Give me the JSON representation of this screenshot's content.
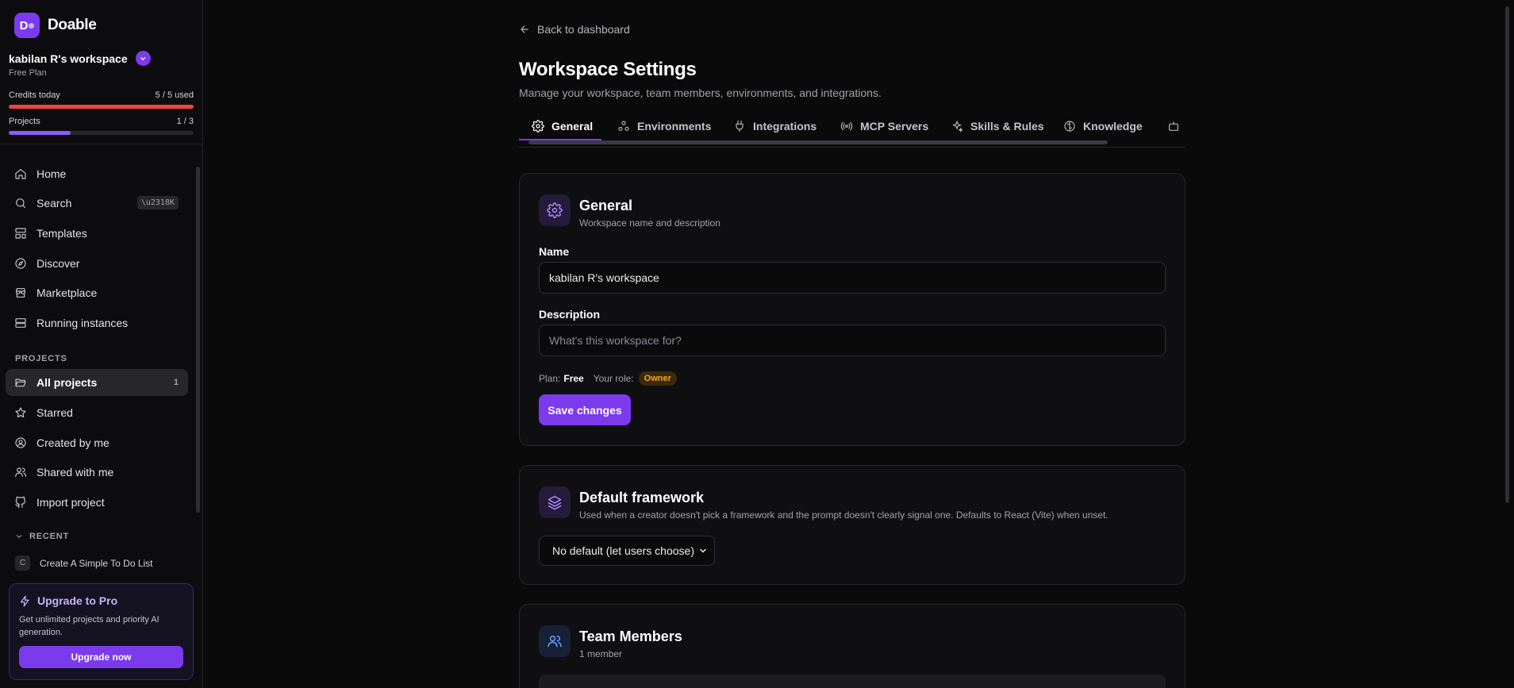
{
  "brand": {
    "name": "Doable",
    "logo_letter": "D"
  },
  "workspace": {
    "name": "kabilan R's workspace",
    "plan": "Free Plan"
  },
  "credits": {
    "label": "Credits today",
    "value": "5 / 5 used",
    "fraction": 1.0,
    "color": "#ef4444"
  },
  "projects_meter": {
    "label": "Projects",
    "value": "1 / 3",
    "fraction": 0.333,
    "color": "#8b5cf6"
  },
  "nav": {
    "home": "Home",
    "search": "Search",
    "search_shortcut": "\\u2318K",
    "templates": "Templates",
    "discover": "Discover",
    "marketplace": "Marketplace",
    "running": "Running instances"
  },
  "projects_section": {
    "label": "PROJECTS",
    "all": "All projects",
    "all_count": "1",
    "starred": "Starred",
    "created": "Created by me",
    "shared": "Shared with me",
    "import": "Import project"
  },
  "recent": {
    "label": "RECENT",
    "item_badge": "C",
    "item": "Create A Simple To Do List"
  },
  "upgrade": {
    "title": "Upgrade to Pro",
    "desc": "Get unlimited projects and priority AI generation.",
    "button": "Upgrade now"
  },
  "header": {
    "back": "Back to dashboard",
    "title": "Workspace Settings",
    "subtitle": "Manage your workspace, team members, environments, and integrations."
  },
  "tabs": [
    "General",
    "Environments",
    "Integrations",
    "MCP Servers",
    "Skills & Rules",
    "Knowledge"
  ],
  "general": {
    "title": "General",
    "subtitle": "Workspace name and description",
    "name_label": "Name",
    "name_value": "kabilan R's workspace",
    "desc_label": "Description",
    "desc_placeholder": "What's this workspace for?",
    "plan_label": "Plan:",
    "plan_value": "Free",
    "role_label": "Your role:",
    "role_value": "Owner",
    "save": "Save changes"
  },
  "framework": {
    "title": "Default framework",
    "subtitle": "Used when a creator doesn't pick a framework and the prompt doesn't clearly signal one. Defaults to React (Vite) when unset.",
    "selected": "No default (let users choose)"
  },
  "team": {
    "title": "Team Members",
    "subtitle": "1 member"
  },
  "colors": {
    "accent": "#7c3aed",
    "background": "#0a0a0b",
    "card": "#0f0f11",
    "owner_badge": "#f5a524"
  }
}
